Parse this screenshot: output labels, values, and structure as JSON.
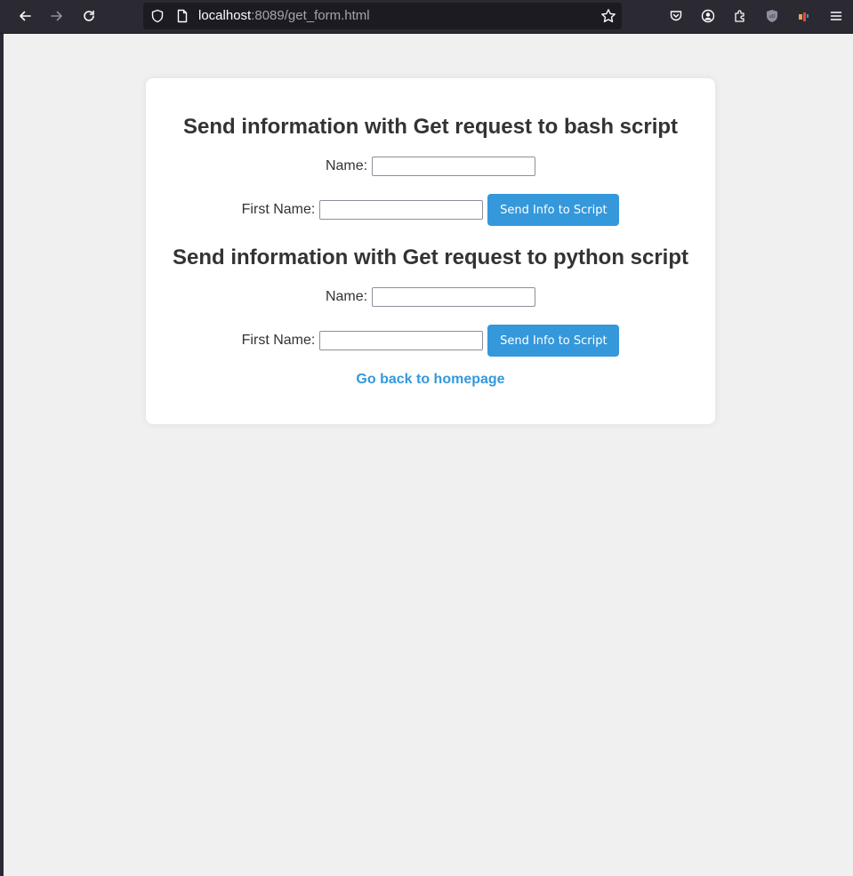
{
  "browser": {
    "url_host": "localhost",
    "url_rest": ":8089/get_form.html"
  },
  "sections": [
    {
      "heading": "Send information with Get request to bash script",
      "name_label": "Name:",
      "name_value": "",
      "firstname_label": "First Name:",
      "firstname_value": "",
      "button_label": "Send Info to Script"
    },
    {
      "heading": "Send information with Get request to python script",
      "name_label": "Name:",
      "name_value": "",
      "firstname_label": "First Name:",
      "firstname_value": "",
      "button_label": "Send Info to Script"
    }
  ],
  "home_link": "Go back to homepage",
  "colors": {
    "accent": "#3498db",
    "page_bg": "#f0f0f0",
    "toolbar_bg": "#2b2a33"
  }
}
